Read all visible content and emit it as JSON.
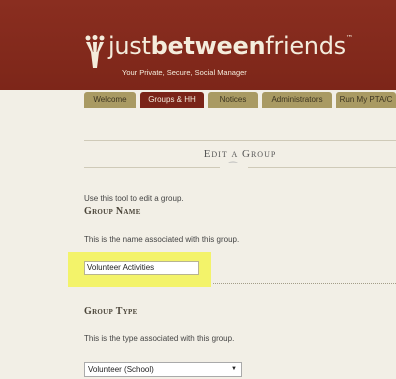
{
  "header": {
    "logo_part1": "just",
    "logo_part2": "between",
    "logo_part3": "friends",
    "trademark": "™",
    "tagline": "Your Private, Secure, Social Manager",
    "background_color": "#7d2619"
  },
  "tabs": [
    {
      "label": "Welcome",
      "active": false
    },
    {
      "label": "Groups & HH",
      "active": true
    },
    {
      "label": "Notices",
      "active": false
    },
    {
      "label": "Administrators",
      "active": false
    },
    {
      "label": "Run My PTA/C",
      "active": false
    }
  ],
  "page": {
    "title": "Edit a Group",
    "intro": "Use this tool to edit a group.",
    "group_name": {
      "heading": "Group Name",
      "description": "This is the name associated with this group.",
      "value": "Volunteer Activities"
    },
    "group_type": {
      "heading": "Group Type",
      "description": "This is the type associated with this group.",
      "selected": "Volunteer (School)"
    }
  }
}
